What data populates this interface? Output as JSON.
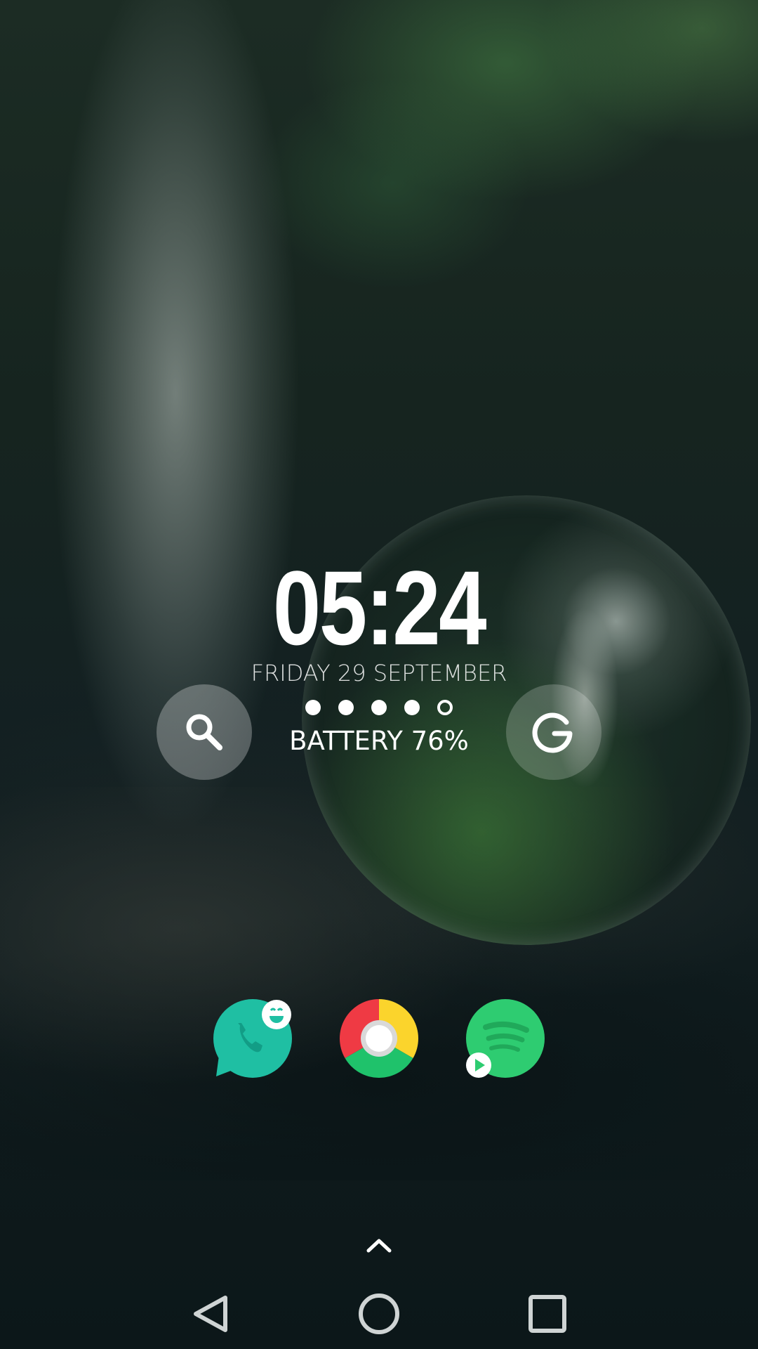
{
  "clock": {
    "time": "05:24",
    "date": "FRIDAY 29 SEPTEMBER"
  },
  "battery": {
    "label": "BATTERY 76%",
    "level_percent": 76,
    "dots_filled": 4,
    "dots_total": 5
  },
  "widget_buttons": [
    {
      "name": "search-button",
      "icon": "search-icon"
    },
    {
      "name": "google-button",
      "icon": "google-icon"
    }
  ],
  "dock": {
    "apps": [
      {
        "name": "phone-app",
        "icon": "phone-icon",
        "badge": "smiley-icon",
        "color": "#1fbfa3"
      },
      {
        "name": "chrome-app",
        "icon": "chrome-icon",
        "colors": [
          "#ef3a44",
          "#fbd42c",
          "#1fc26b"
        ]
      },
      {
        "name": "spotify-app",
        "icon": "spotify-icon",
        "badge": "play-icon",
        "color": "#2ecc71"
      }
    ]
  },
  "drawer": {
    "icon": "chevron-up-icon"
  },
  "navbar": {
    "buttons": [
      {
        "name": "back",
        "icon": "triangle-back-icon"
      },
      {
        "name": "home",
        "icon": "circle-home-icon"
      },
      {
        "name": "recents",
        "icon": "square-recents-icon"
      }
    ]
  }
}
